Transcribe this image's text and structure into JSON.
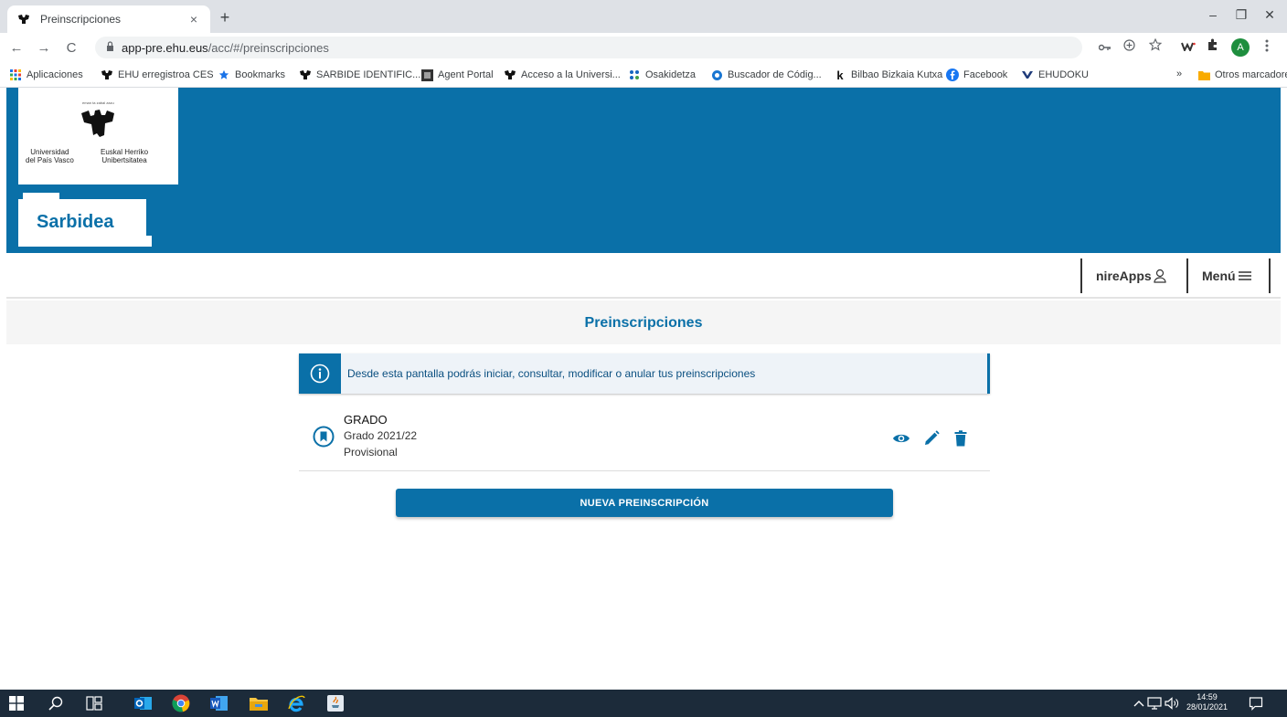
{
  "browser": {
    "tab_title": "Preinscripciones",
    "tab_close": "×",
    "new_tab": "+",
    "window_controls": {
      "minimize": "–",
      "restore": "❐",
      "close": "✕"
    },
    "nav": {
      "back": "←",
      "forward": "→",
      "reload": "C"
    },
    "url_host": "app-pre.ehu.eus",
    "url_path": "/acc/#/preinscripciones",
    "profile_initial": "A",
    "bookmarks": [
      {
        "label": "Aplicaciones",
        "icon": "apps-grid-icon"
      },
      {
        "label": "EHU erregistroa CES",
        "icon": "ehu-icon"
      },
      {
        "label": "Bookmarks",
        "icon": "star-icon"
      },
      {
        "label": "SARBIDE IDENTIFIC...",
        "icon": "ehu-icon"
      },
      {
        "label": "Agent Portal",
        "icon": "portal-icon"
      },
      {
        "label": "Acceso a la Universi...",
        "icon": "ehu-icon"
      },
      {
        "label": "Osakidetza",
        "icon": "osakidetza-icon"
      },
      {
        "label": "Buscador de Códig...",
        "icon": "search-code-icon"
      },
      {
        "label": "Bilbao Bizkaia Kutxa",
        "icon": "kutxa-icon"
      },
      {
        "label": "Facebook",
        "icon": "facebook-icon"
      },
      {
        "label": "EHUDOKU",
        "icon": "ehudoku-icon"
      }
    ],
    "bookmarks_more": "»",
    "other_bookmarks": "Otros marcadores"
  },
  "site": {
    "logo_tagline": "eman ta zabal zazu",
    "logo_left_line1": "Universidad",
    "logo_left_line2": "del País Vasco",
    "logo_right_line1": "Euskal Herriko",
    "logo_right_line2": "Unibertsitatea",
    "brand": "Sarbidea",
    "nav": {
      "apps": "nireApps",
      "menu": "Menú"
    }
  },
  "page": {
    "title": "Preinscripciones",
    "info": "Desde esta pantalla podrás iniciar, consultar, modificar o anular tus preinscripciones",
    "item": {
      "type": "GRADO",
      "name": "Grado 2021/22",
      "status": "Provisional"
    },
    "new_button": "NUEVA PREINSCRIPCIÓN"
  },
  "taskbar": {
    "time": "14:59",
    "date": "28/01/2021"
  },
  "colors": {
    "primary": "#0a70a8",
    "taskbar": "#1c2b3a"
  }
}
